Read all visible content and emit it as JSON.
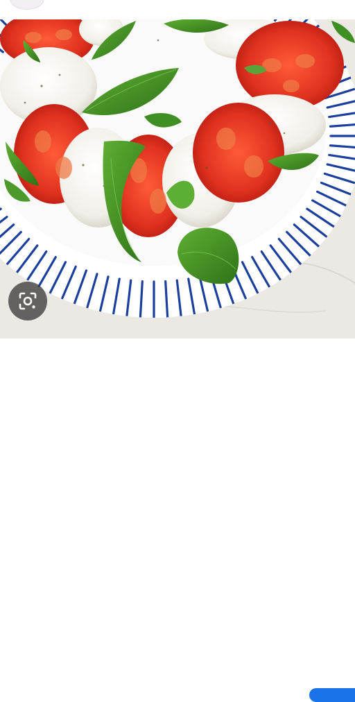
{
  "image": {
    "subject": "",
    "colors": {
      "background": "#ffffff",
      "plate": "#ffffff",
      "stripes": "#1b3f9c",
      "tomato": "#d7291d",
      "mozzarella": "#f4f2ec",
      "basil": "#3f8f25",
      "marble": "#ece9e5"
    }
  },
  "lens": {
    "icon": "lens-search-icon"
  },
  "caption": {
    "text": ""
  }
}
